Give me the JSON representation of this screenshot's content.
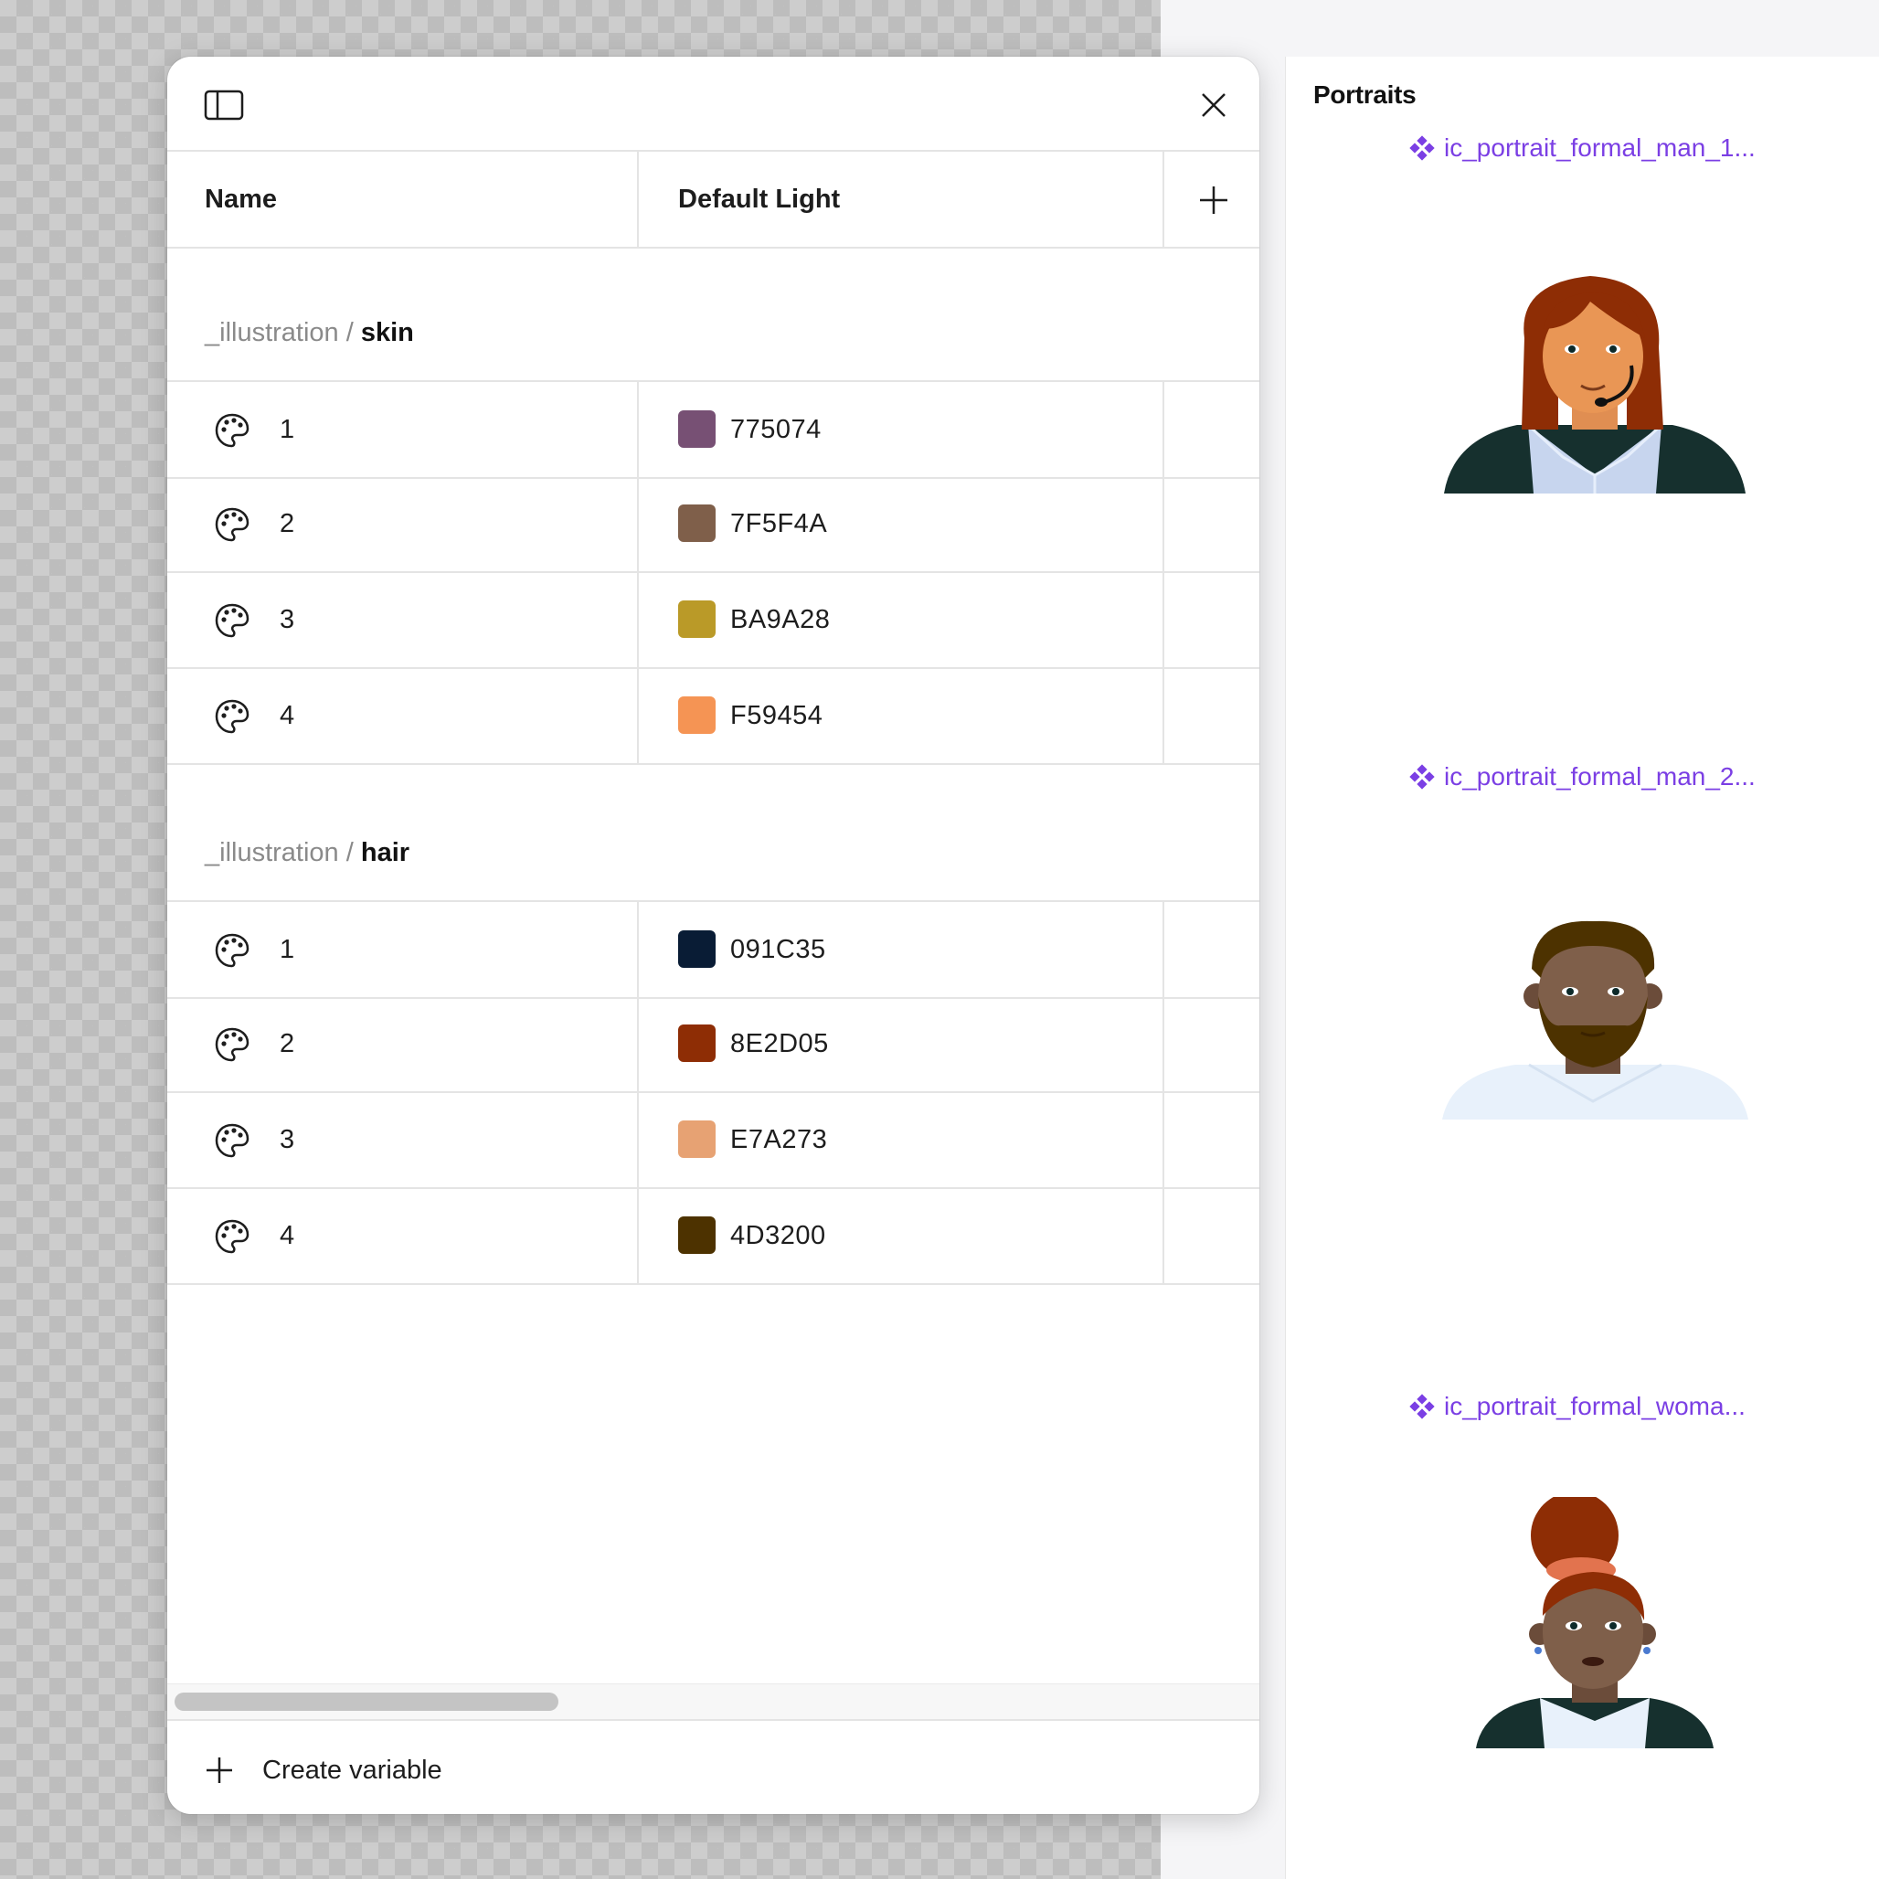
{
  "right_panel": {
    "frame_title": "Portraits",
    "components": [
      {
        "label": "ic_portrait_formal_man_1...",
        "icon": "component-icon"
      },
      {
        "label": "ic_portrait_formal_man_2...",
        "icon": "component-icon"
      },
      {
        "label": "ic_portrait_formal_woma...",
        "icon": "component-icon"
      }
    ],
    "accent_color": "#7b3fe4"
  },
  "dialog": {
    "header": {
      "sidebar_icon": "sidebar-toggle-icon",
      "close_icon": "close-icon"
    },
    "columns": {
      "name": "Name",
      "mode": "Default Light",
      "add_icon": "plus-icon"
    },
    "groups": [
      {
        "prefix": "_illustration / ",
        "name": "skin",
        "variables": [
          {
            "name": "1",
            "hex": "775074",
            "color": "#775074"
          },
          {
            "name": "2",
            "hex": "7F5F4A",
            "color": "#7F5F4A"
          },
          {
            "name": "3",
            "hex": "BA9A28",
            "color": "#BA9A28"
          },
          {
            "name": "4",
            "hex": "F59454",
            "color": "#F59454"
          }
        ]
      },
      {
        "prefix": "_illustration / ",
        "name": "hair",
        "variables": [
          {
            "name": "1",
            "hex": "091C35",
            "color": "#091C35"
          },
          {
            "name": "2",
            "hex": "8E2D05",
            "color": "#8E2D05"
          },
          {
            "name": "3",
            "hex": "E7A273",
            "color": "#E7A273"
          },
          {
            "name": "4",
            "hex": "4D3200",
            "color": "#4D3200"
          }
        ]
      }
    ],
    "footer": {
      "create_label": "Create variable",
      "create_icon": "plus-icon"
    }
  }
}
